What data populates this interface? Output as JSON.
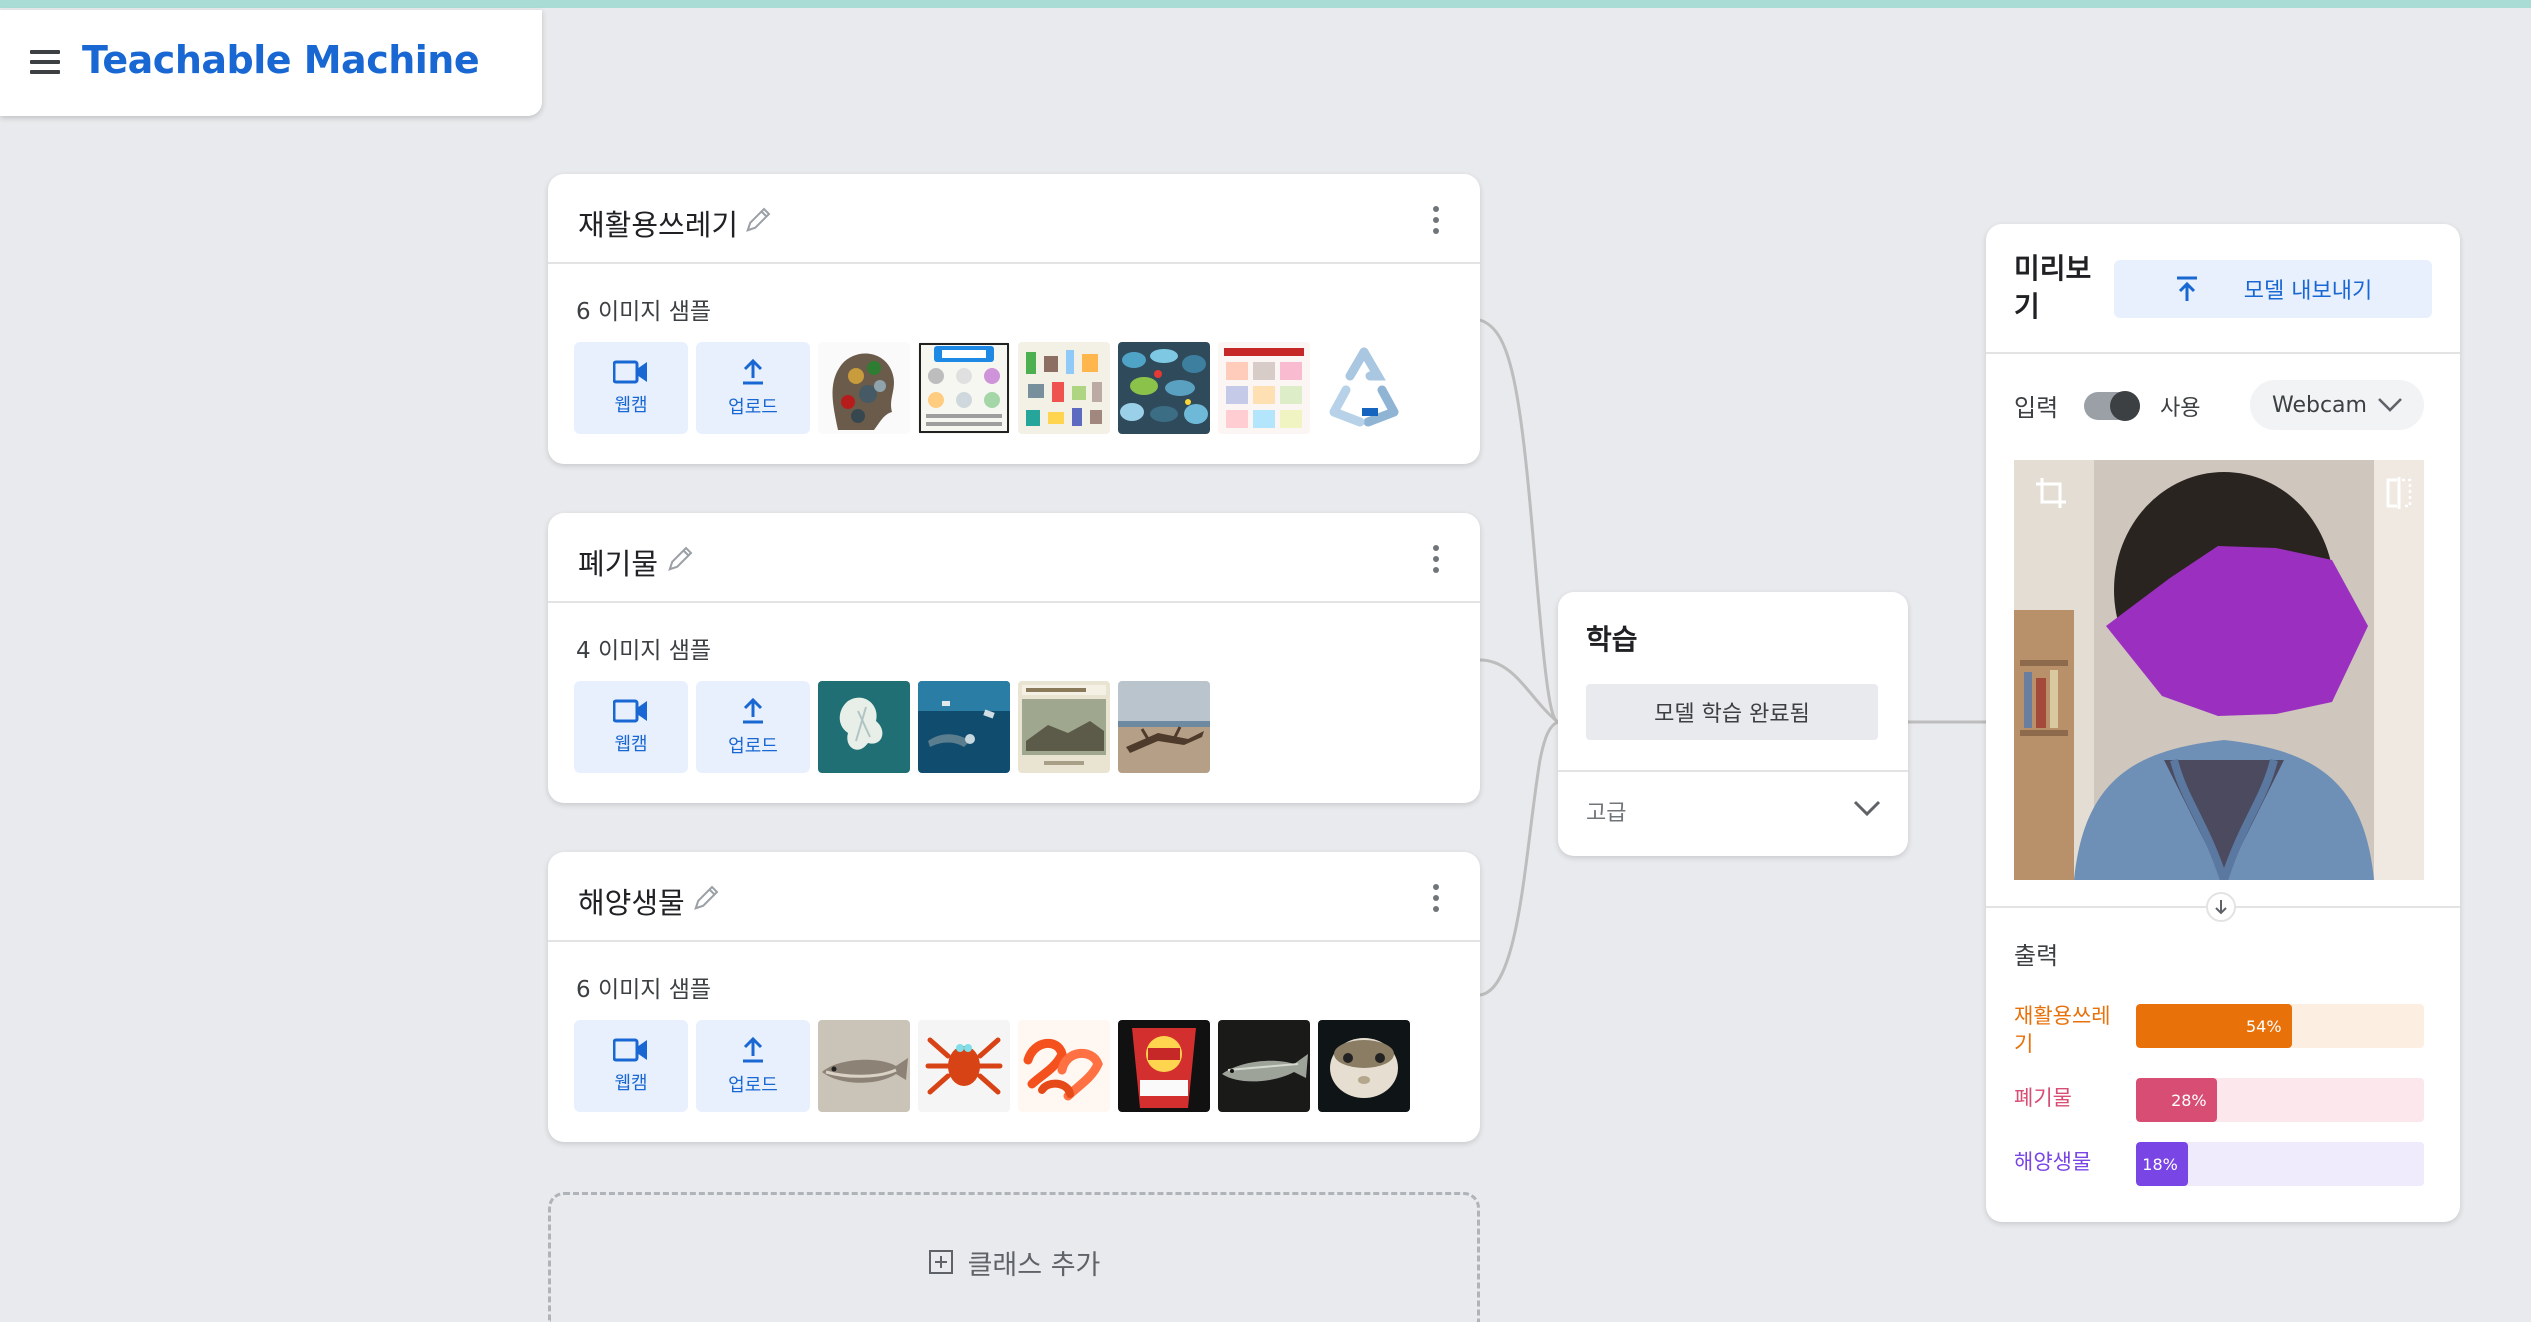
{
  "app": {
    "title": "Teachable Machine"
  },
  "classes": [
    {
      "name": "재활용쓰레기",
      "sample_count": "6 이미지 샘플",
      "webcam_label": "웹캠",
      "upload_label": "업로드",
      "thumbnails": [
        "trash-head-collage",
        "recycling-guide-poster",
        "recyclable-items-chart",
        "plastic-bottles-pile",
        "recycling-rules-poster",
        "recycle-symbol"
      ]
    },
    {
      "name": "폐기물",
      "sample_count": "4 이미지 샘플",
      "webcam_label": "웹캠",
      "upload_label": "업로드",
      "thumbnails": [
        "ocean-plastic-bag",
        "diver-with-debris",
        "beach-waste-news",
        "driftwood-shore"
      ]
    },
    {
      "name": "해양생물",
      "sample_count": "6 이미지 샘플",
      "webcam_label": "웹캠",
      "upload_label": "업로드",
      "thumbnails": [
        "fish-on-tray",
        "red-crab",
        "shrimps",
        "snack-bag-fish",
        "sturgeon",
        "pufferfish"
      ]
    }
  ],
  "training": {
    "title": "학습",
    "button_label": "모델 학습 완료됨",
    "advanced_label": "고급"
  },
  "preview": {
    "title": "미리보기",
    "export_label": "모델 내보내기",
    "input_label": "입력",
    "toggle_label": "사용",
    "input_enabled": true,
    "source_value": "Webcam",
    "output_label": "출력",
    "outputs": [
      {
        "name": "재활용쓰레기",
        "percent_label": "54%",
        "value": 0.54,
        "color": "#e8710a",
        "track": "#fdeee2"
      },
      {
        "name": "폐기물",
        "percent_label": "28%",
        "value": 0.28,
        "color": "#d74d73",
        "track": "#fce8ec"
      },
      {
        "name": "해양생물",
        "percent_label": "18%",
        "value": 0.18,
        "color": "#7a45e5",
        "track": "#efeafc"
      }
    ]
  },
  "add_class": {
    "label": "클래스 추가"
  }
}
